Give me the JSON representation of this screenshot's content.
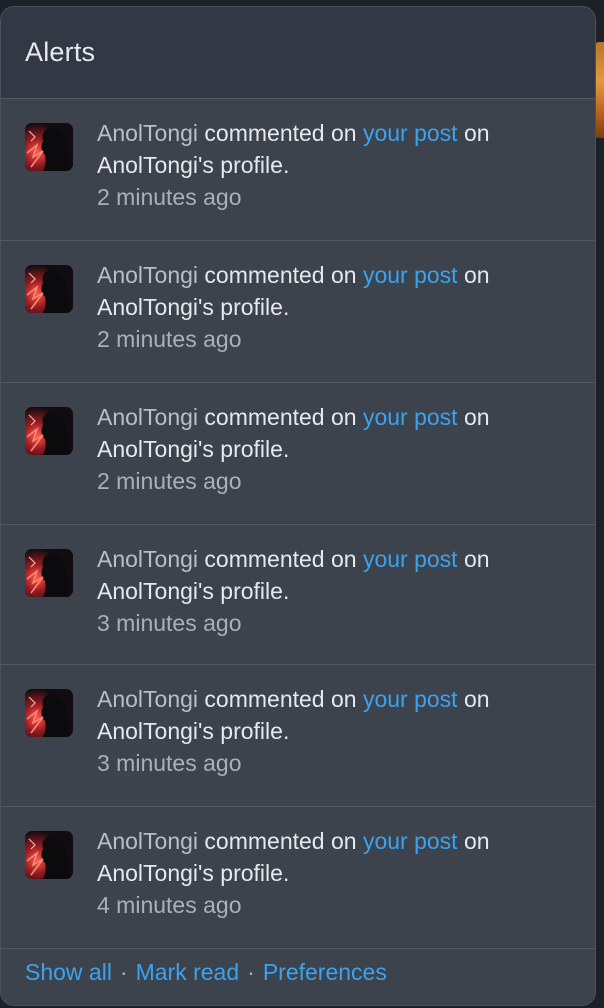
{
  "panel": {
    "title": "Alerts"
  },
  "alerts": [
    {
      "user": "AnolTongi",
      "action": "commented on",
      "link": "your post",
      "suffix": "on",
      "target": "AnolTongi's profile.",
      "time": "2 minutes ago"
    },
    {
      "user": "AnolTongi",
      "action": "commented on",
      "link": "your post",
      "suffix": "on",
      "target": "AnolTongi's profile.",
      "time": "2 minutes ago"
    },
    {
      "user": "AnolTongi",
      "action": "commented on",
      "link": "your post",
      "suffix": "on",
      "target": "AnolTongi's profile.",
      "time": "2 minutes ago"
    },
    {
      "user": "AnolTongi",
      "action": "commented on",
      "link": "your post",
      "suffix": "on",
      "target": "AnolTongi's profile.",
      "time": "3 minutes ago"
    },
    {
      "user": "AnolTongi",
      "action": "commented on",
      "link": "your post",
      "suffix": "on",
      "target": "AnolTongi's profile.",
      "time": "3 minutes ago"
    },
    {
      "user": "AnolTongi",
      "action": "commented on",
      "link": "your post",
      "suffix": "on",
      "target": "AnolTongi's profile.",
      "time": "4 minutes ago"
    }
  ],
  "footer": {
    "show_all": "Show all",
    "separator": "·",
    "mark_read": "Mark read",
    "preferences": "Preferences"
  },
  "colors": {
    "panel_bg": "#3d434d",
    "header_bg": "#323844",
    "link": "#3aa3f0",
    "muted_text": "#a9b0ba"
  }
}
